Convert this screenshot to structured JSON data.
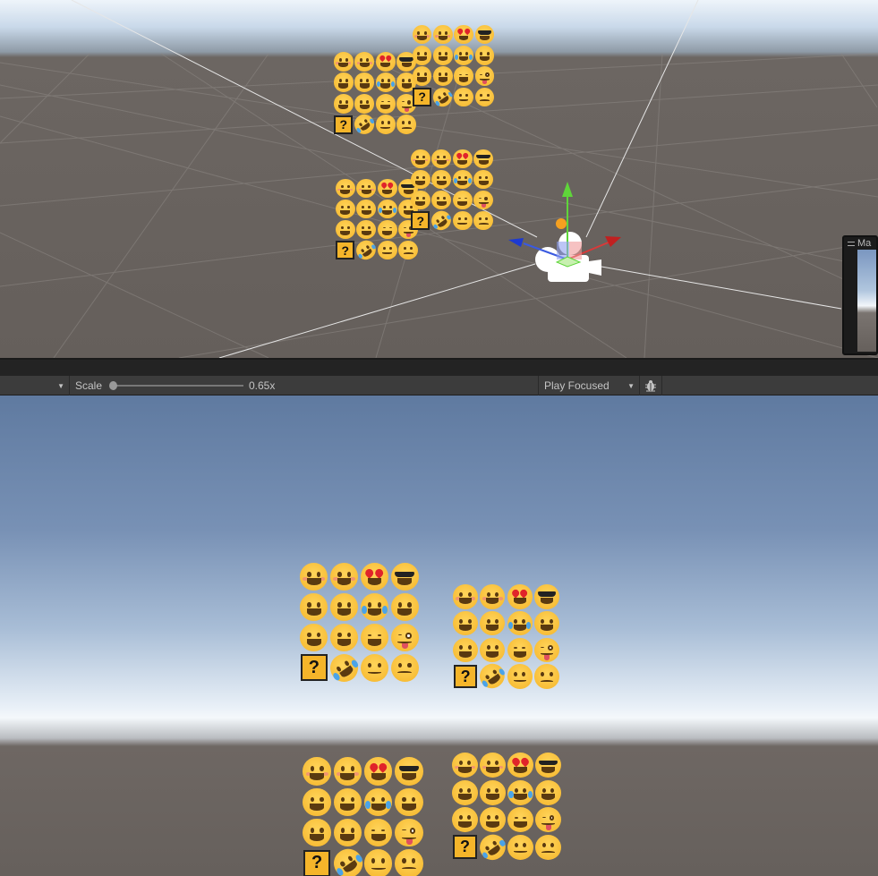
{
  "toolbar": {
    "scale_label": "Scale",
    "scale_value": "0.65x",
    "scale_fraction": 0.0,
    "play_mode": "Play Focused",
    "bug_icon": "bug-icon"
  },
  "scene_view": {
    "camera_preview_title": "Ma"
  },
  "emoji_grid": [
    "smiling-blush",
    "smile",
    "heart-eyes",
    "sunglasses",
    "grin",
    "grin-sweat",
    "tears-of-joy",
    "grin",
    "grin",
    "grin-sweat",
    "tired",
    "tongue-wink",
    "question-box",
    "rofl",
    "slight-smile",
    "frown"
  ],
  "question_mark": "?",
  "colors": {
    "sky_top": "#5f7aa0",
    "ground": "#66605c",
    "emoji_yellow": "#f5b52a",
    "toolbar": "#3c3c3c"
  }
}
